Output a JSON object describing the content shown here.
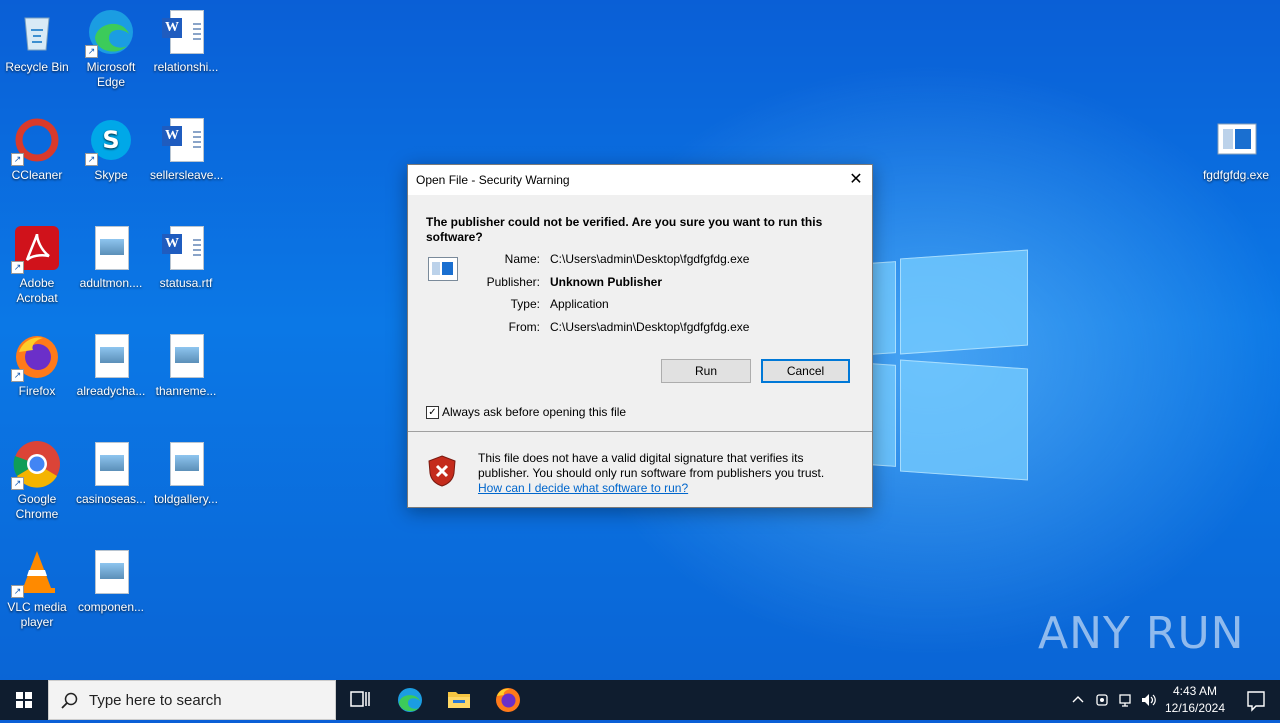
{
  "desktop": {
    "icons": [
      {
        "label": "Recycle Bin"
      },
      {
        "label": "Microsoft Edge"
      },
      {
        "label": "relationshi..."
      },
      {
        "label": "CCleaner"
      },
      {
        "label": "Skype"
      },
      {
        "label": "sellersleave..."
      },
      {
        "label": "Adobe Acrobat"
      },
      {
        "label": "adultmon...."
      },
      {
        "label": "statusa.rtf"
      },
      {
        "label": "Firefox"
      },
      {
        "label": "alreadycha..."
      },
      {
        "label": "thanreme..."
      },
      {
        "label": "Google Chrome"
      },
      {
        "label": "casinoseas..."
      },
      {
        "label": "toldgallery..."
      },
      {
        "label": "VLC media player"
      },
      {
        "label": "componen..."
      },
      {
        "label": "fgdfgfdg.exe"
      }
    ],
    "watermark": "ANY RUN"
  },
  "dialog": {
    "title": "Open File - Security Warning",
    "close": "✕",
    "question": "The publisher could not be verified.  Are you sure you want to run this software?",
    "name_label": "Name:",
    "name_value": "C:\\Users\\admin\\Desktop\\fgdfgfdg.exe",
    "publisher_label": "Publisher:",
    "publisher_value": "Unknown Publisher",
    "type_label": "Type:",
    "type_value": "Application",
    "from_label": "From:",
    "from_value": "C:\\Users\\admin\\Desktop\\fgdfgfdg.exe",
    "run_button": "Run",
    "cancel_button": "Cancel",
    "checkbox_label": "Always ask before opening this file",
    "checkbox_checked": true,
    "warning_text": "This file does not have a valid digital signature that verifies its publisher.  You should only run software from publishers you trust.",
    "help_link": "How can I decide what software to run?"
  },
  "taskbar": {
    "search_placeholder": "Type here to search",
    "time": "4:43 AM",
    "date": "12/16/2024"
  }
}
